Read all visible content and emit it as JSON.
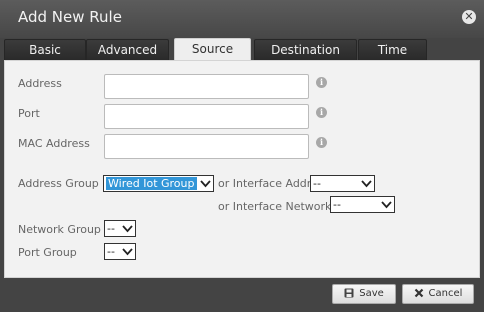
{
  "dialog": {
    "title": "Add New Rule",
    "close_icon": "close-icon"
  },
  "tabs": [
    {
      "label": "Basic",
      "active": false
    },
    {
      "label": "Advanced",
      "active": false
    },
    {
      "label": "Source",
      "active": true
    },
    {
      "label": "Destination",
      "active": false
    },
    {
      "label": "Time",
      "active": false
    }
  ],
  "form": {
    "address_label": "Address",
    "address_value": "",
    "port_label": "Port",
    "port_value": "",
    "mac_label": "MAC Address",
    "mac_value": "",
    "info_glyph": "i",
    "address_group_label": "Address Group",
    "address_group_value": "Wired Iot Group",
    "interface_addr_label": "or Interface Addr",
    "interface_addr_value": "--",
    "interface_network_label": "or Interface Network",
    "interface_network_value": "--",
    "network_group_label": "Network Group",
    "network_group_value": "--",
    "port_group_label": "Port Group",
    "port_group_value": "--"
  },
  "footer": {
    "save_label": "Save",
    "cancel_label": "Cancel"
  },
  "colors": {
    "selection": "#3296d8",
    "titlebar": "#4e4e4e",
    "panel": "#f2f2f2"
  }
}
